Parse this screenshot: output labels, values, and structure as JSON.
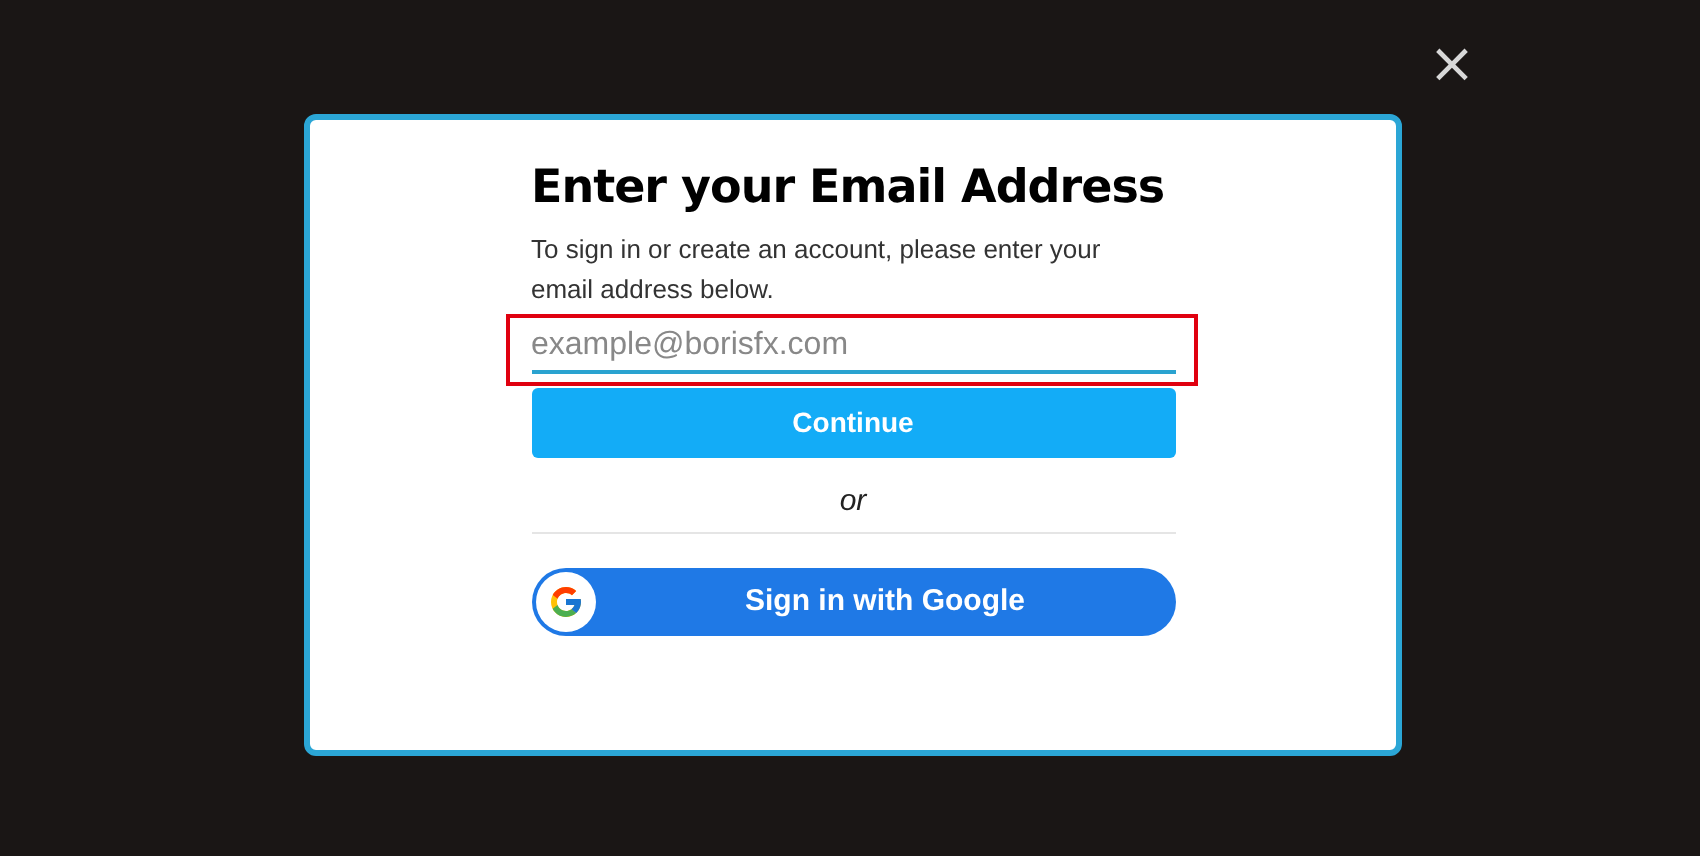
{
  "close_button": {
    "label": "×"
  },
  "dialog": {
    "title": "Enter your Email Address",
    "description": "To sign in or create an account, please enter your email address below.",
    "email_field": {
      "placeholder": "example@borisfx.com",
      "highlighted": true
    },
    "continue_button": {
      "label": "Continue"
    },
    "divider_text": "or",
    "google_button": {
      "label": "Sign in with Google"
    }
  }
}
